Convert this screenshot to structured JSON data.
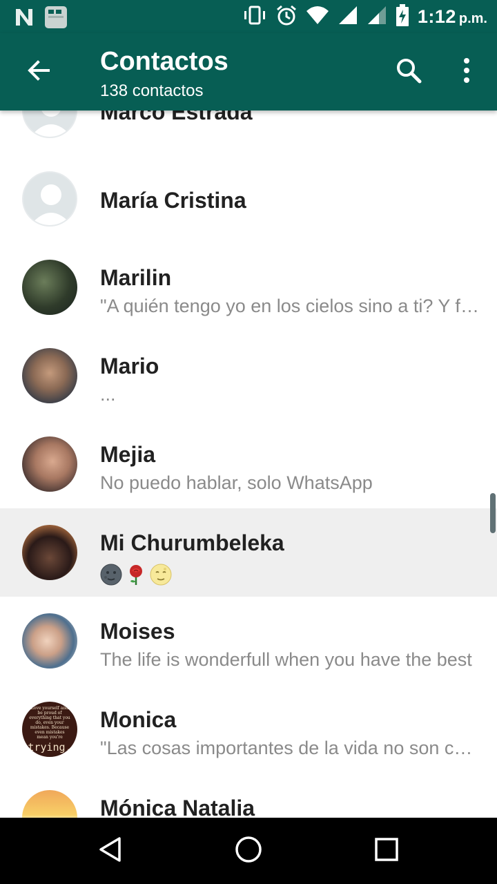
{
  "status_bar": {
    "time": "1:12",
    "ampm": "p.m.",
    "left_icons": [
      "n-notification-icon",
      "gallery-notification-icon"
    ],
    "right_icons": [
      "vibrate-icon",
      "alarm-icon",
      "wifi-icon",
      "signal-icon",
      "signal-2-icon",
      "battery-charging-icon"
    ]
  },
  "app_bar": {
    "title": "Contactos",
    "subtitle": "138 contactos",
    "back_icon": "arrow-back-icon",
    "search_icon": "search-icon",
    "menu_icon": "more-vert-icon",
    "color": "#075e54"
  },
  "contacts": [
    {
      "name": "Marco Estrada",
      "status": ""
    },
    {
      "name": "María Cristina",
      "status": ""
    },
    {
      "name": "Marilin",
      "status": "\"A quién tengo yo en los cielos sino a ti? Y fuera de ti nada deseo en la tierra\""
    },
    {
      "name": "Mario",
      "status": "..."
    },
    {
      "name": "Mejia",
      "status": "No puedo hablar, solo WhatsApp"
    },
    {
      "name": "Mi Churumbeleka",
      "status_emojis": [
        "new-moon-face-emoji",
        "rose-emoji",
        "full-moon-face-emoji"
      ]
    },
    {
      "name": "Moises",
      "status": "The life is wonderfull when you have the best"
    },
    {
      "name": "Monica",
      "status": "\"Las cosas importantes de la vida no son cosas\""
    },
    {
      "name": "Mónica Natalia",
      "status": ""
    }
  ],
  "avatar_text": {
    "monica_small": "Love yourself and be proud of everything that you do, even your mistakes. Because even mistakes mean you're",
    "monica_big": "trying."
  },
  "nav_bar": {
    "back_icon": "nav-back-triangle-icon",
    "home_icon": "nav-home-circle-icon",
    "recents_icon": "nav-recents-square-icon"
  }
}
